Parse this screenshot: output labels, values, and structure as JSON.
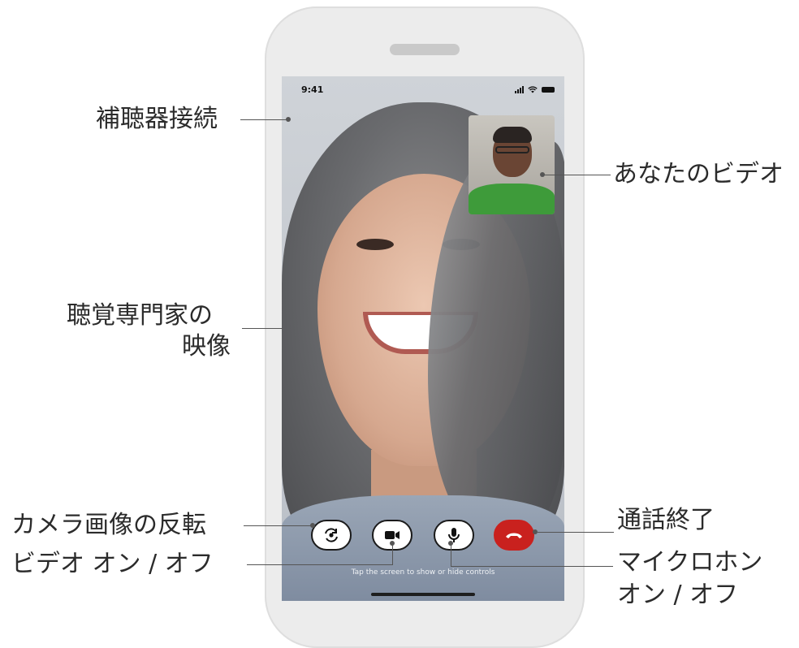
{
  "phone": {
    "status": {
      "time": "9:41"
    },
    "hint": "Tap the screen to show or hide controls",
    "controls": [
      {
        "name": "flip-camera",
        "icon": "flip-camera-icon"
      },
      {
        "name": "video-toggle",
        "icon": "video-camera-icon"
      },
      {
        "name": "mic-toggle",
        "icon": "microphone-icon"
      },
      {
        "name": "end-call",
        "icon": "phone-hangup-icon",
        "color": "#c9211e"
      }
    ]
  },
  "callouts": {
    "hearing_aid": "補聴器接続",
    "professional_video_line1": "聴覚専門家の",
    "professional_video_line2": "映像",
    "your_video": "あなたのビデオ",
    "flip_camera": "カメラ画像の反転",
    "video_toggle": "ビデオ オン / オフ",
    "end_call": "通話終了",
    "mic_line1": "マイクロホン",
    "mic_line2": "オン / オフ"
  }
}
